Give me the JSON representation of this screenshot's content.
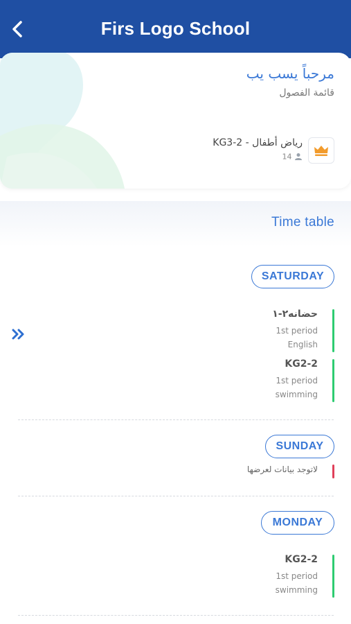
{
  "header": {
    "title": "Firs Logo School"
  },
  "welcome": {
    "greeting": "مرحباً يسب يب",
    "subtitle": "قائمة الفصول"
  },
  "class_item": {
    "name": "KG3-2 - رياض أطفال",
    "student_count": "14"
  },
  "timetable": {
    "title": "Time table",
    "days": [
      {
        "name": "SATURDAY",
        "entries": [
          {
            "class": "حضانه٢-١",
            "period": "1st period",
            "subject": "English"
          },
          {
            "class": "KG2-2",
            "period": "1st period",
            "subject": "swimming"
          }
        ]
      },
      {
        "name": "SUNDAY",
        "no_data": "لاتوجد بيانات لعرضها"
      },
      {
        "name": "MONDAY",
        "entries": [
          {
            "class": "KG2-2",
            "period": "1st period",
            "subject": "swimming"
          }
        ]
      }
    ]
  },
  "colors": {
    "brand": "#1f4fa3",
    "accent": "#3a78d6",
    "active_bar": "#2ecc71",
    "empty_bar": "#e0405a"
  },
  "icons": {
    "back": "chevron-left-icon",
    "class": "crown-icon",
    "students": "person-icon",
    "expand": "double-chevron-right-icon"
  }
}
